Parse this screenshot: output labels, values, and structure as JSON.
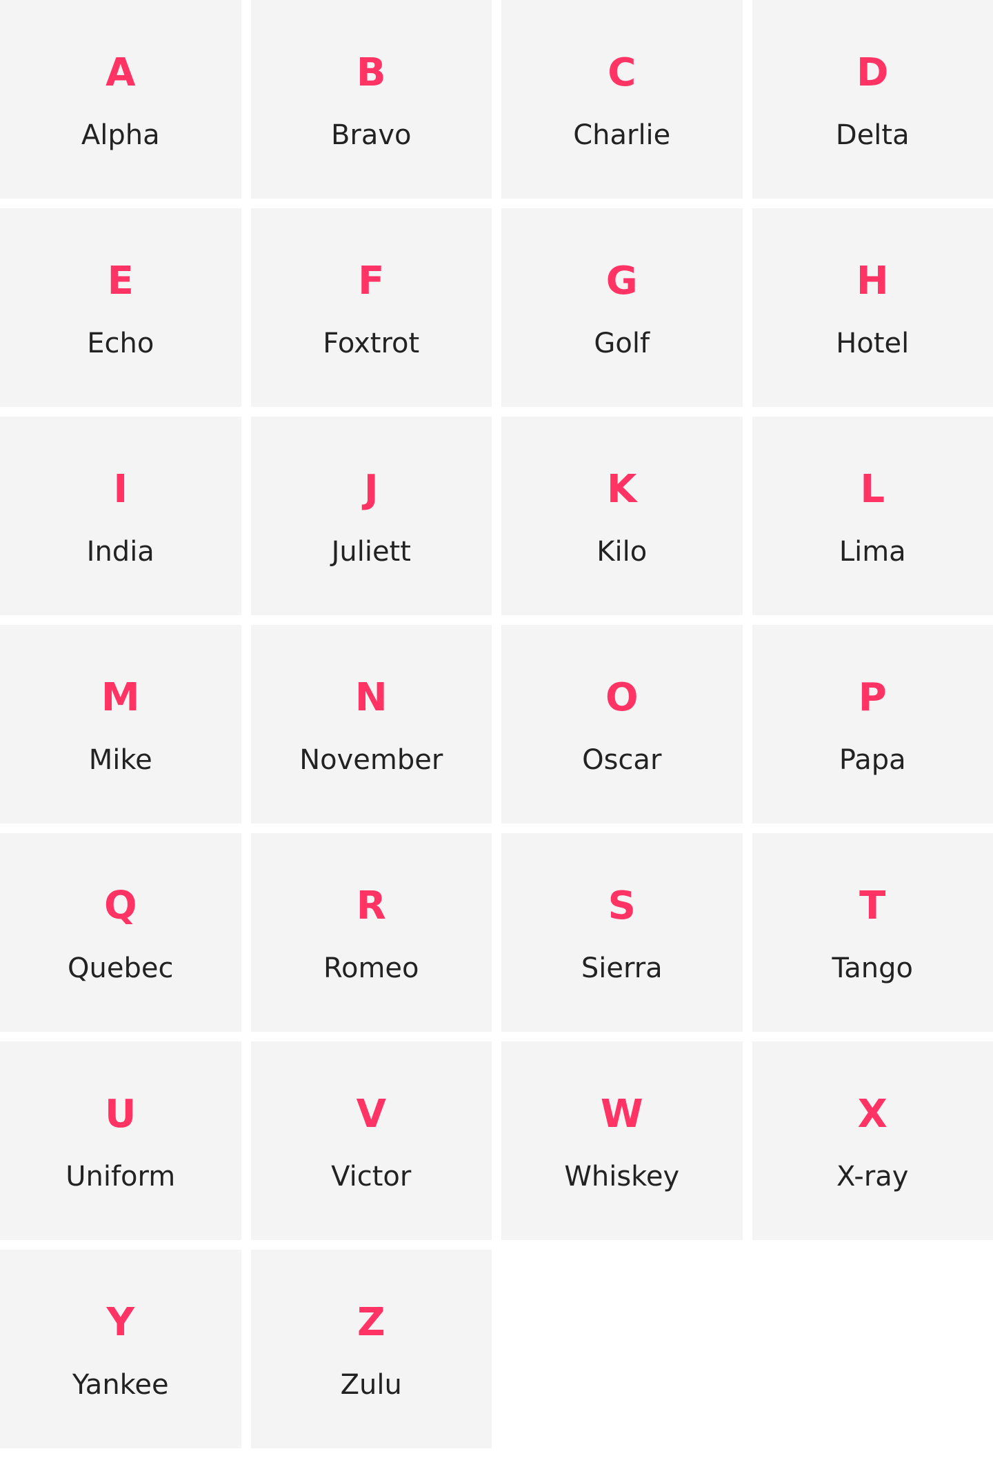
{
  "colors": {
    "accent": "#ff3465",
    "text": "#222222",
    "card_bg": "#f4f4f4"
  },
  "alphabet": [
    {
      "letter": "A",
      "word": "Alpha"
    },
    {
      "letter": "B",
      "word": "Bravo"
    },
    {
      "letter": "C",
      "word": "Charlie"
    },
    {
      "letter": "D",
      "word": "Delta"
    },
    {
      "letter": "E",
      "word": "Echo"
    },
    {
      "letter": "F",
      "word": "Foxtrot"
    },
    {
      "letter": "G",
      "word": "Golf"
    },
    {
      "letter": "H",
      "word": "Hotel"
    },
    {
      "letter": "I",
      "word": "India"
    },
    {
      "letter": "J",
      "word": "Juliett"
    },
    {
      "letter": "K",
      "word": "Kilo"
    },
    {
      "letter": "L",
      "word": "Lima"
    },
    {
      "letter": "M",
      "word": "Mike"
    },
    {
      "letter": "N",
      "word": "November"
    },
    {
      "letter": "O",
      "word": "Oscar"
    },
    {
      "letter": "P",
      "word": "Papa"
    },
    {
      "letter": "Q",
      "word": "Quebec"
    },
    {
      "letter": "R",
      "word": "Romeo"
    },
    {
      "letter": "S",
      "word": "Sierra"
    },
    {
      "letter": "T",
      "word": "Tango"
    },
    {
      "letter": "U",
      "word": "Uniform"
    },
    {
      "letter": "V",
      "word": "Victor"
    },
    {
      "letter": "W",
      "word": "Whiskey"
    },
    {
      "letter": "X",
      "word": "X-ray"
    },
    {
      "letter": "Y",
      "word": "Yankee"
    },
    {
      "letter": "Z",
      "word": "Zulu"
    }
  ]
}
